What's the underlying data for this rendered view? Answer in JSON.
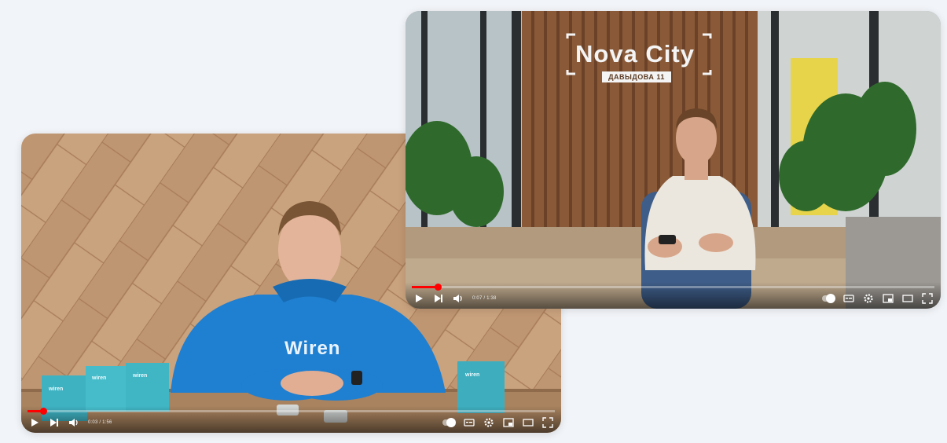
{
  "players": [
    {
      "id": "left",
      "time_text": "0:03 / 1:56",
      "progress": 0.03,
      "hoodie_text": "Wiren",
      "box_label": "wiren"
    },
    {
      "id": "right",
      "time_text": "0:07 / 1:38",
      "progress": 0.05,
      "sign_title": "Nova City",
      "sign_sub": "ДАВЫДОВА 11"
    }
  ],
  "icons": [
    "play-icon",
    "next-icon",
    "volume-icon",
    "autoplay-toggle",
    "subtitles-icon",
    "settings-icon",
    "miniplayer-icon",
    "theater-icon",
    "fullscreen-icon"
  ],
  "colors": {
    "progress": "#ff0000",
    "hoodie": "#1f7fd0",
    "wood": "#c9a27e",
    "sofa": "#c0aa8e"
  }
}
